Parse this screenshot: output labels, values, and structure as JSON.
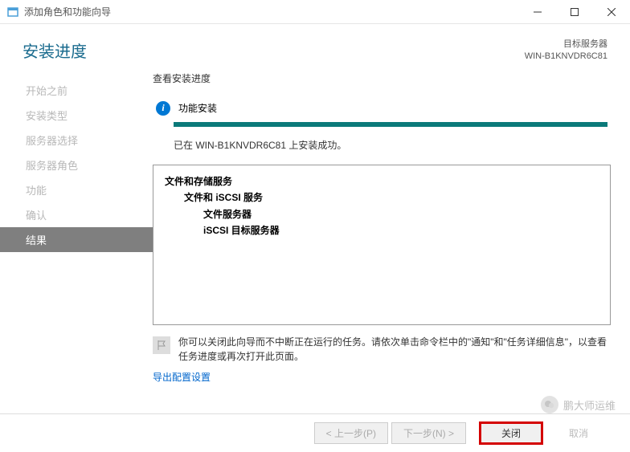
{
  "window": {
    "title": "添加角色和功能向导"
  },
  "header": {
    "title": "安装进度",
    "target_label": "目标服务器",
    "target_server": "WIN-B1KNVDR6C81"
  },
  "sidebar": {
    "items": [
      {
        "label": "开始之前"
      },
      {
        "label": "安装类型"
      },
      {
        "label": "服务器选择"
      },
      {
        "label": "服务器角色"
      },
      {
        "label": "功能"
      },
      {
        "label": "确认"
      },
      {
        "label": "结果"
      }
    ],
    "active_index": 6
  },
  "content": {
    "view_label": "查看安装进度",
    "status": "功能安装",
    "result_message": "已在 WIN-B1KNVDR6C81 上安装成功。",
    "details": [
      {
        "level": 0,
        "text": "文件和存储服务"
      },
      {
        "level": 1,
        "text": "文件和 iSCSI 服务"
      },
      {
        "level": 2,
        "text": "文件服务器"
      },
      {
        "level": 2,
        "text": "iSCSI 目标服务器"
      }
    ],
    "note": "你可以关闭此向导而不中断正在运行的任务。请依次单击命令栏中的\"通知\"和\"任务详细信息\"，以查看任务进度或再次打开此页面。",
    "export_link": "导出配置设置"
  },
  "footer": {
    "prev": "< 上一步(P)",
    "next": "下一步(N) >",
    "close": "关闭",
    "cancel": "取消"
  },
  "watermark": "鹏大师运维"
}
